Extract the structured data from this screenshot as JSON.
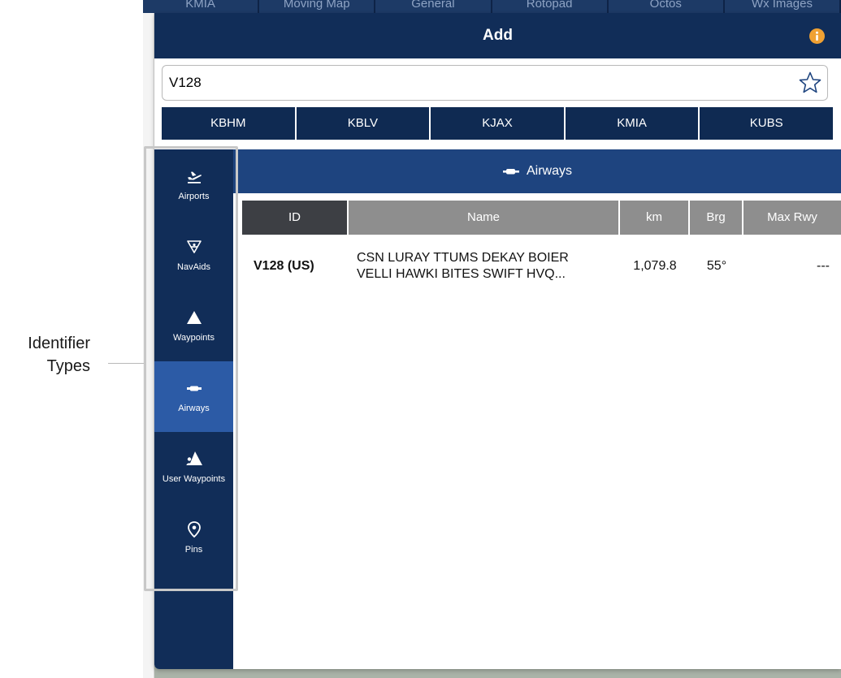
{
  "background": {
    "tabs": [
      "KMIA",
      "Moving Map",
      "General",
      "Rotopad",
      "Octos",
      "Wx Images"
    ]
  },
  "modal": {
    "title": "Add",
    "info_icon": "info-icon",
    "colors": {
      "header": "#112d58",
      "active": "#2c5ba6",
      "section": "#1e447f",
      "info": "#f0a133"
    }
  },
  "search": {
    "value": "V128",
    "favorite_icon": "star-outline-icon"
  },
  "recent_airports": [
    "KBHM",
    "KBLV",
    "KJAX",
    "KMIA",
    "KUBS"
  ],
  "sidebar": {
    "items": [
      {
        "label": "Airports",
        "icon": "airplane-takeoff-icon",
        "active": false
      },
      {
        "label": "NavAids",
        "icon": "navaid-icon",
        "active": false
      },
      {
        "label": "Waypoints",
        "icon": "triangle-icon",
        "active": false
      },
      {
        "label": "Airways",
        "icon": "airway-icon",
        "active": true
      },
      {
        "label": "User Waypoints",
        "icon": "user-waypoint-icon",
        "active": false
      },
      {
        "label": "Pins",
        "icon": "pin-icon",
        "active": false
      }
    ]
  },
  "section": {
    "title": "Airways",
    "icon": "airway-icon"
  },
  "table": {
    "columns": [
      "ID",
      "Name",
      "km",
      "Brg",
      "Max Rwy"
    ],
    "rows": [
      {
        "id": "V128 (US)",
        "name_line1": "CSN LURAY TTUMS DEKAY BOIER",
        "name_line2": "VELLI HAWKI BITES SWIFT HVQ...",
        "km": "1,079.8",
        "brg": "55°",
        "rwy": "---"
      }
    ]
  },
  "annotation": {
    "line1": "Identifier",
    "line2": "Types"
  }
}
